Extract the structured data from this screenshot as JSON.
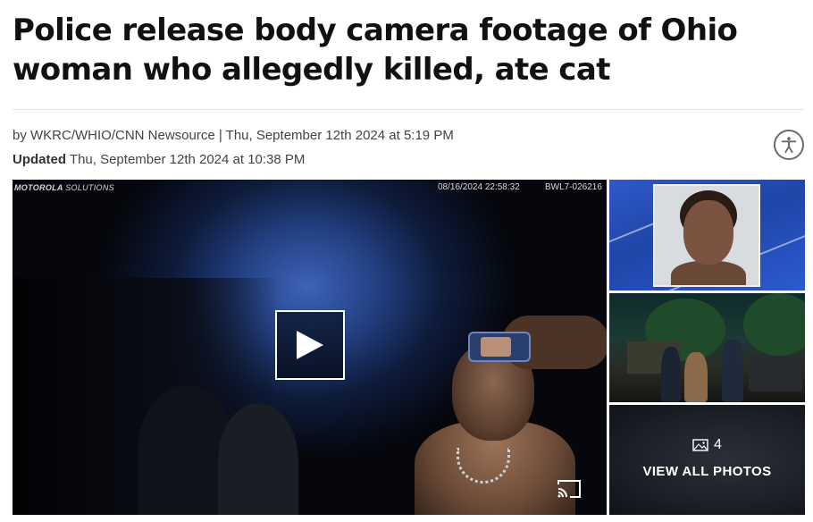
{
  "article": {
    "headline": "Police release body camera footage of Ohio woman who allegedly killed, ate cat",
    "byline": "by WKRC/WHIO/CNN Newsource | Thu, September 12th 2024 at 5:19 PM",
    "updated_label": "Updated",
    "updated_value": "Thu, September 12th 2024 at 10:38 PM"
  },
  "video": {
    "overlay_brand": "MOTOROLA",
    "overlay_brand_suffix": "SOLUTIONS",
    "overlay_timestamp": "08/16/2024 22:58:32",
    "overlay_camera_id": "BWL7-026216"
  },
  "gallery": {
    "photo_count": "4",
    "view_all_label": "VIEW ALL PHOTOS"
  },
  "icons": {
    "accessibility": "accessibility-icon",
    "play": "play-icon",
    "cast": "cast-icon",
    "photos": "image-icon"
  },
  "colors": {
    "headline": "#111111",
    "meta_text": "#444444",
    "overlay_text": "#ffffff"
  }
}
